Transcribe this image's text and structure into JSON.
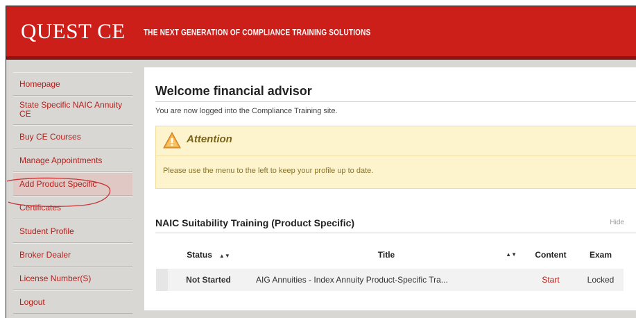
{
  "header": {
    "logo_text": "QUEST CE",
    "tagline": "THE NEXT GENERATION OF COMPLIANCE TRAINING SOLUTIONS"
  },
  "sidebar": {
    "items": [
      {
        "label": "Homepage",
        "lines": 1
      },
      {
        "label": "State Specific NAIC Annuity CE",
        "lines": 2
      },
      {
        "label": "Buy CE Courses",
        "lines": 1
      },
      {
        "label": "Manage Appointments",
        "lines": 1
      },
      {
        "label": "Add Product Specific",
        "lines": 1
      },
      {
        "label": "Certificates",
        "lines": 1
      },
      {
        "label": "Student Profile",
        "lines": 1
      },
      {
        "label": "Broker Dealer",
        "lines": 1
      },
      {
        "label": "License Number(S)",
        "lines": 1
      },
      {
        "label": "Logout",
        "lines": 1
      }
    ],
    "active_index": 4
  },
  "main": {
    "welcome": "Welcome financial advisor",
    "intro": "You are now logged into the Compliance Training site.",
    "attention": {
      "title": "Attention",
      "message": "Please use the menu to the left to keep your profile up to date."
    },
    "section": {
      "title": "NAIC Suitability Training (Product Specific)",
      "hide_label": "Hide"
    },
    "table": {
      "headers": {
        "status": "Status",
        "title": "Title",
        "content": "Content",
        "exam": "Exam"
      },
      "rows": [
        {
          "status": "Not Started",
          "title": "AIG Annuities - Index Annuity Product-Specific Tra...",
          "content": "Start",
          "exam": "Locked"
        }
      ]
    }
  },
  "colors": {
    "brand_red": "#cc1f1a",
    "link_red": "#b2201b",
    "attention_bg": "#fdf3cd",
    "sidebar_bg": "#d9d7d4"
  }
}
